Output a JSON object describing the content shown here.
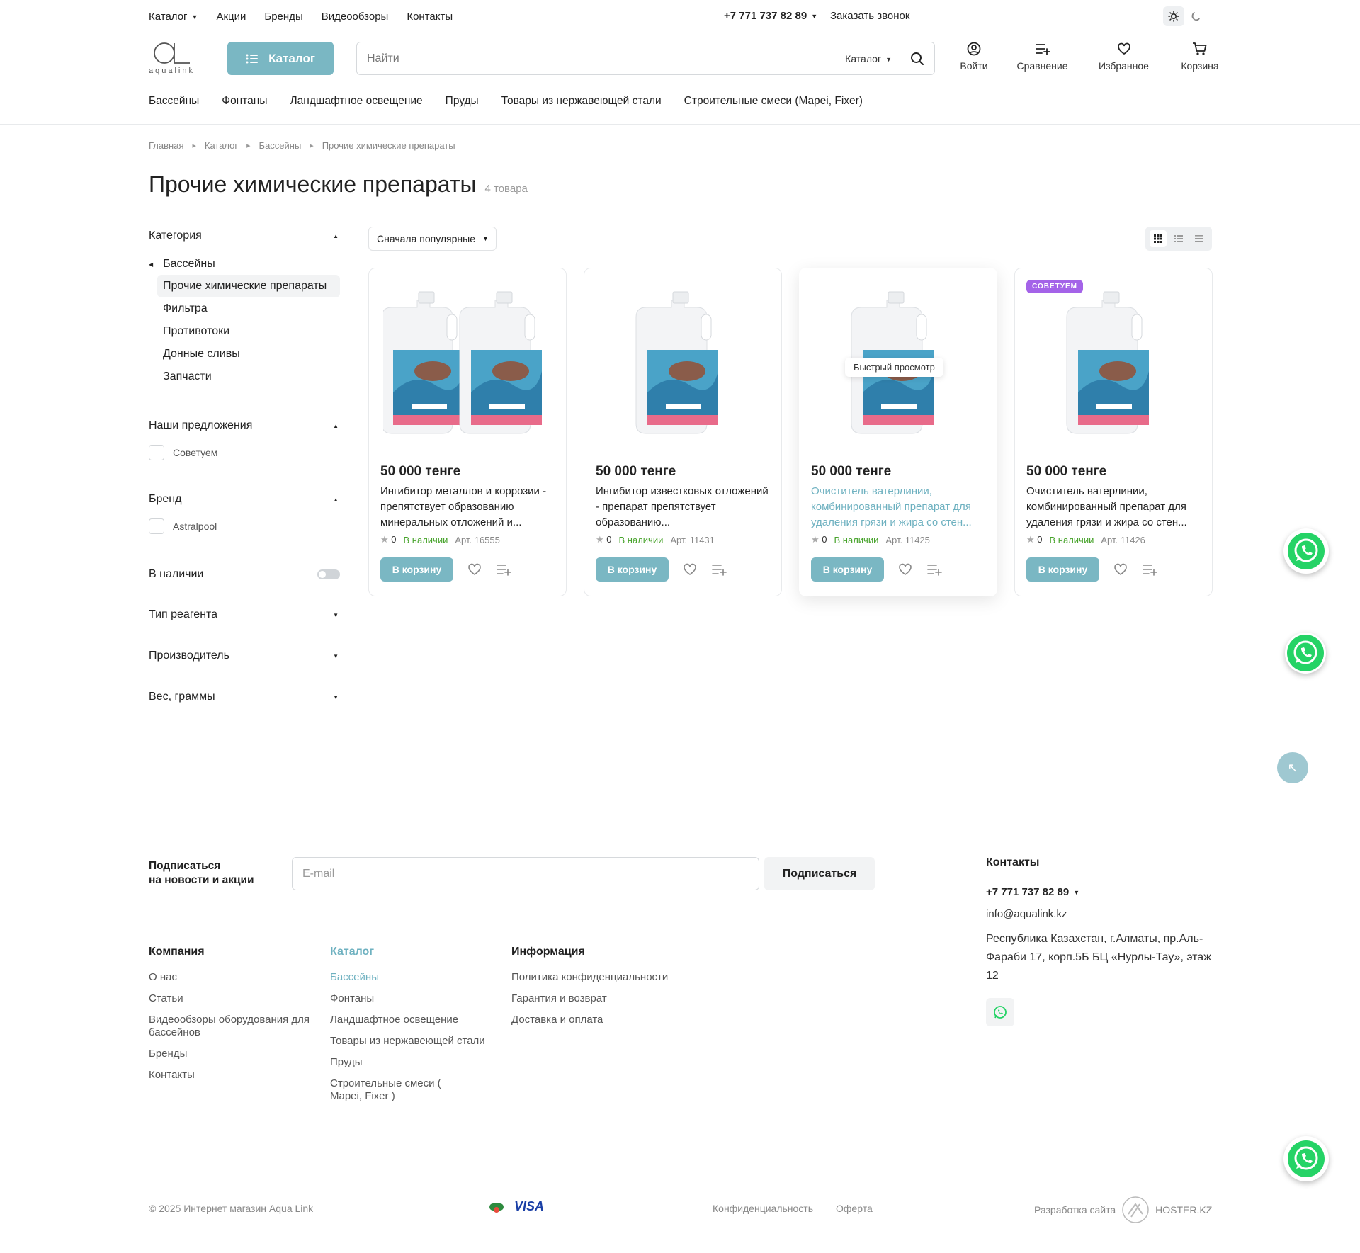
{
  "topbar": {
    "nav": [
      {
        "label": "Каталог",
        "caret": true
      },
      {
        "label": "Акции"
      },
      {
        "label": "Бренды"
      },
      {
        "label": "Видеообзоры"
      },
      {
        "label": "Контакты"
      }
    ],
    "phone": "+7 771 737 82 89",
    "callback": "Заказать звонок"
  },
  "header": {
    "logo_text": "aqualink",
    "catalog_button": "Каталог",
    "search_placeholder": "Найти",
    "search_scope": "Каталог",
    "icons": [
      {
        "label": "Войти",
        "icon": "user-icon"
      },
      {
        "label": "Сравнение",
        "icon": "compare-icon"
      },
      {
        "label": "Избранное",
        "icon": "heart-icon"
      },
      {
        "label": "Корзина",
        "icon": "cart-icon"
      }
    ]
  },
  "main_menu": [
    "Бассейны",
    "Фонтаны",
    "Ландшафтное освещение",
    "Пруды",
    "Товары из нержавеющей стали",
    "Строительные смеси (Mapei, Fixer)"
  ],
  "breadcrumbs": [
    "Главная",
    "Каталог",
    "Бассейны",
    "Прочие химические препараты"
  ],
  "page": {
    "title": "Прочие химические препараты",
    "count": "4 товара"
  },
  "filters": {
    "category": {
      "title": "Категория",
      "parent": "Бассейны",
      "items": [
        "Прочие химические препараты",
        "Фильтра",
        "Противотоки",
        "Донные сливы",
        "Запчасти"
      ]
    },
    "offers": {
      "title": "Наши предложения",
      "option": "Советуем"
    },
    "brand": {
      "title": "Бренд",
      "option": "Astralpool"
    },
    "stock": {
      "title": "В наличии"
    },
    "collapsed": [
      "Тип реагента",
      "Производитель",
      "Вес, граммы"
    ]
  },
  "sort": {
    "label": "Сначала популярные"
  },
  "products": [
    {
      "price": "50 000 тенге",
      "name": "Ингибитор металлов и коррозии - препятствует образованию минеральных отложений и...",
      "rating": "0",
      "stock": "В наличии",
      "sku": "Арт. 16555",
      "buy": "В корзину"
    },
    {
      "price": "50 000 тенге",
      "name": "Ингибитор известковых отложений - препарат препятствует образованию...",
      "rating": "0",
      "stock": "В наличии",
      "sku": "Арт. 11431",
      "buy": "В корзину"
    },
    {
      "price": "50 000 тенге",
      "name": "Очиститель ватерлинии, комбинированный препарат для удаления грязи и жира со стен...",
      "rating": "0",
      "stock": "В наличии",
      "sku": "Арт. 11425",
      "buy": "В корзину",
      "quick_view": "Быстрый просмотр"
    },
    {
      "price": "50 000 тенге",
      "name": "Очиститель ватерлинии, комбинированный препарат для удаления грязи и жира со стен...",
      "rating": "0",
      "stock": "В наличии",
      "sku": "Арт. 11426",
      "buy": "В корзину",
      "badge": "СОВЕТУЕМ"
    }
  ],
  "subscribe": {
    "title_line1": "Подписаться",
    "title_line2": "на новости и акции",
    "placeholder": "E-mail",
    "button": "Подписаться"
  },
  "footer": {
    "company": {
      "title": "Компания",
      "items": [
        "О нас",
        "Статьи",
        "Видеообзоры оборудования для бассейнов",
        "Бренды",
        "Контакты"
      ]
    },
    "catalog": {
      "title": "Каталог",
      "items": [
        "Бассейны",
        "Фонтаны",
        "Ландшафтное освещение",
        "Товары из нержавеющей стали",
        "Пруды",
        "Строительные смеси ( Mapei, Fixer )"
      ]
    },
    "info": {
      "title": "Информация",
      "items": [
        "Политика конфиденциальности",
        "Гарантия и возврат",
        "Доставка и оплата"
      ]
    },
    "contacts": {
      "title": "Контакты",
      "phone": "+7 771 737 82 89",
      "email": "info@aqualink.kz",
      "address": "Республика Казахстан, г.Алматы, пр.Аль-Фараби 17, корп.5Б БЦ «Нурлы-Тау», этаж 12"
    },
    "copyright": "© 2025 Интернет магазин Aqua Link",
    "payments": [
      "VISA"
    ],
    "links": [
      "Конфиденциальность",
      "Оферта"
    ],
    "developer_label": "Разработка сайта",
    "developer_name": "HOSTER.KZ"
  },
  "colors": {
    "accent": "#7ab7c3",
    "link_accent": "#6eb1c0",
    "badge": "#a463e8",
    "stock": "#47a32b",
    "whatsapp": "#25d366"
  }
}
